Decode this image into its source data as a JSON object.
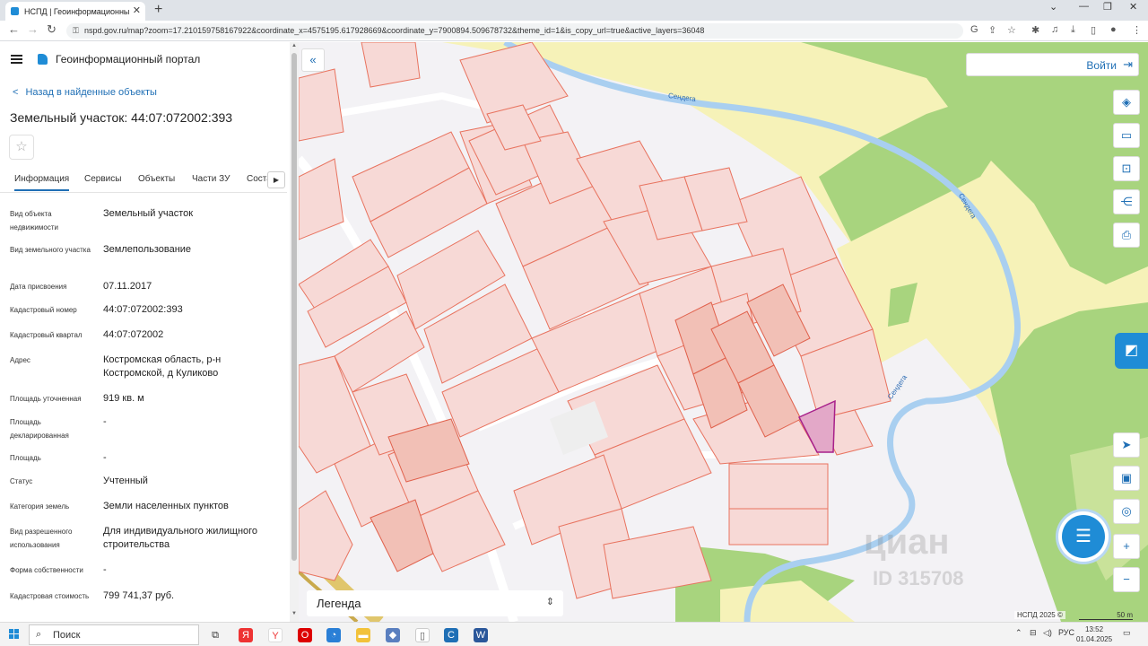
{
  "browser": {
    "tab_title": "НСПД | Геоинформационный п",
    "url": "nspd.gov.ru/map?zoom=17.210159758167922&coordinate_x=4575195.617928669&coordinate_y=7900894.509678732&theme_id=1&is_copy_url=true&active_layers=36048"
  },
  "header": {
    "portal_title": "Геоинформационный портал"
  },
  "panel": {
    "back_label": "Назад в найденные объекты",
    "object_title": "Земельный участок: 44:07:072002:393",
    "tabs": [
      "Информация",
      "Сервисы",
      "Объекты",
      "Части ЗУ",
      "Соста"
    ],
    "rows": [
      {
        "label": "Вид объекта недвижимости",
        "value": "Земельный участок"
      },
      {
        "label": "Вид земельного участка",
        "value": "Землепользование"
      },
      {
        "label": "Дата присвоения",
        "value": "07.11.2017"
      },
      {
        "label": "Кадастровый номер",
        "value": "44:07:072002:393"
      },
      {
        "label": "Кадастровый квартал",
        "value": "44:07:072002"
      },
      {
        "label": "Адрес",
        "value": "Костромская область, р-н Костромской, д Куликово"
      },
      {
        "label": "Площадь уточненная",
        "value": "919 кв. м"
      },
      {
        "label": "Площадь декларированная",
        "value": "-"
      },
      {
        "label": "Площадь",
        "value": "-"
      },
      {
        "label": "Статус",
        "value": "Учтенный"
      },
      {
        "label": "Категория земель",
        "value": "Земли населенных пунктов"
      },
      {
        "label": "Вид разрешенного использования",
        "value": "Для индивидуального жилищного строительства"
      },
      {
        "label": "Форма собственности",
        "value": "-"
      },
      {
        "label": "Кадастровая стоимость",
        "value": "799 741,37 руб."
      }
    ]
  },
  "map": {
    "login_label": "Войти",
    "legend_label": "Легенда",
    "attribution": "НСПД 2025 ©",
    "scale": "50 m",
    "river_label_1": "Сендега",
    "river_label_2": "Сендега",
    "river_label_3": "Сендега",
    "watermark": "циан",
    "watermark_id": "ID 315708"
  },
  "taskbar": {
    "search_label": "Поиск",
    "lang": "РУС",
    "time": "13:52",
    "date": "01.04.2025"
  },
  "colors": {
    "accent": "#1f6fb5",
    "parcel_fill": "#f7d9d6",
    "parcel_stroke": "#e8735f",
    "selected_fill": "#e3a8c8",
    "selected_stroke": "#a8208a",
    "forest": "#a8d47e",
    "field": "#f6f2b8",
    "river": "#a9cff0"
  }
}
